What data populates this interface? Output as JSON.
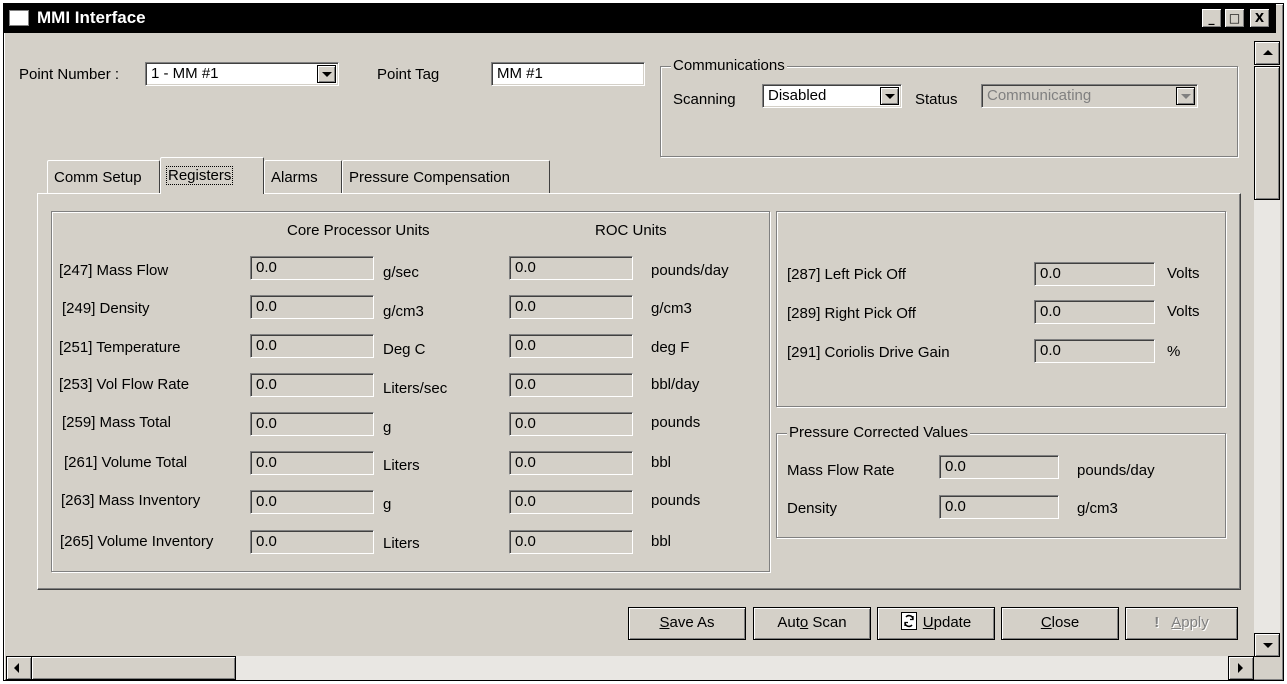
{
  "window": {
    "title": "MMI Interface",
    "minimize_glyph": "_",
    "maximize_glyph": "□",
    "close_glyph": "X"
  },
  "header": {
    "point_number_label": "Point Number :",
    "point_number_value": "1 - MM #1",
    "point_tag_label": "Point Tag",
    "point_tag_value": "MM #1"
  },
  "communications": {
    "title": "Communications",
    "scanning_label": "Scanning",
    "scanning_value": "Disabled",
    "status_label": "Status",
    "status_value": "Communicating"
  },
  "tabs": [
    {
      "label": "Comm Setup",
      "active": false
    },
    {
      "label": "Registers",
      "active": true
    },
    {
      "label": "Alarms",
      "active": false
    },
    {
      "label": "Pressure Compensation",
      "active": false
    }
  ],
  "registers": {
    "core_header": "Core Processor Units",
    "roc_header": "ROC Units",
    "rows": [
      {
        "label": "[247] Mass Flow",
        "core_value": "0.0",
        "core_unit": "g/sec",
        "roc_value": "0.0",
        "roc_unit": "pounds/day"
      },
      {
        "label": "[249] Density",
        "core_value": "0.0",
        "core_unit": "g/cm3",
        "roc_value": "0.0",
        "roc_unit": "g/cm3"
      },
      {
        "label": "[251] Temperature",
        "core_value": "0.0",
        "core_unit": "Deg C",
        "roc_value": "0.0",
        "roc_unit": "deg F"
      },
      {
        "label": "[253] Vol Flow Rate",
        "core_value": "0.0",
        "core_unit": "Liters/sec",
        "roc_value": "0.0",
        "roc_unit": "bbl/day"
      },
      {
        "label": "[259] Mass Total",
        "core_value": "0.0",
        "core_unit": "g",
        "roc_value": "0.0",
        "roc_unit": "pounds"
      },
      {
        "label": "[261] Volume Total",
        "core_value": "0.0",
        "core_unit": "Liters",
        "roc_value": "0.0",
        "roc_unit": "bbl"
      },
      {
        "label": "[263] Mass Inventory",
        "core_value": "0.0",
        "core_unit": "g",
        "roc_value": "0.0",
        "roc_unit": "pounds"
      },
      {
        "label": "[265] Volume Inventory",
        "core_value": "0.0",
        "core_unit": "Liters",
        "roc_value": "0.0",
        "roc_unit": "bbl"
      }
    ]
  },
  "diagnostics": {
    "rows": [
      {
        "label": "[287] Left Pick Off",
        "value": "0.0",
        "unit": "Volts"
      },
      {
        "label": "[289] Right Pick Off",
        "value": "0.0",
        "unit": "Volts"
      },
      {
        "label": "[291] Coriolis Drive Gain",
        "value": "0.0",
        "unit": "%"
      }
    ]
  },
  "pressure_corrected": {
    "title": "Pressure Corrected Values",
    "rows": [
      {
        "label": "Mass Flow Rate",
        "value": "0.0",
        "unit": "pounds/day"
      },
      {
        "label": "Density",
        "value": "0.0",
        "unit": "g/cm3"
      }
    ]
  },
  "buttons": {
    "save_as": {
      "mnemonic": "S",
      "rest": "ave As"
    },
    "auto_scan": {
      "pre": "Aut",
      "mnemonic": "o",
      "rest": " Scan"
    },
    "update": {
      "mnemonic": "U",
      "rest": "pdate",
      "icon": "refresh-icon"
    },
    "close": {
      "mnemonic": "C",
      "rest": "lose"
    },
    "apply": {
      "mnemonic": "A",
      "rest": "pply",
      "icon": "exclamation-icon",
      "enabled": false
    }
  }
}
